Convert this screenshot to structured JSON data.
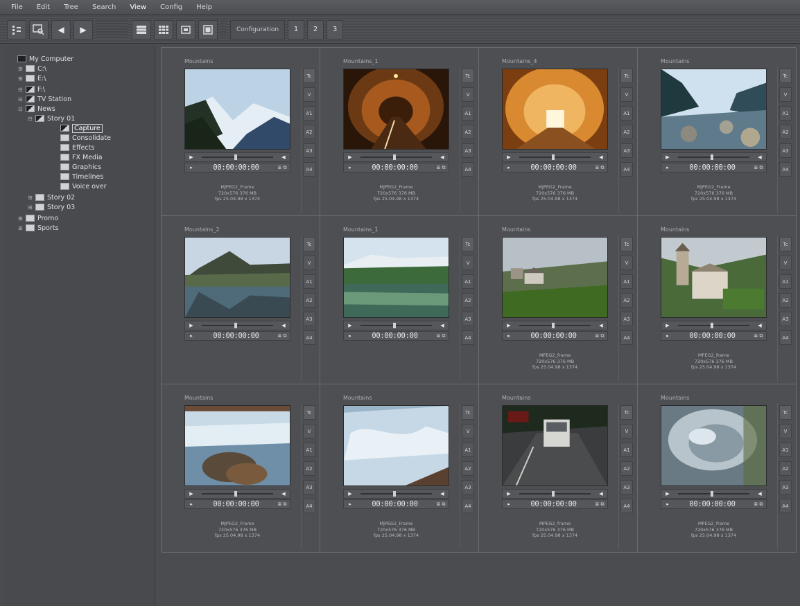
{
  "menu": [
    "File",
    "Edit",
    "Tree",
    "Search",
    "View",
    "Config",
    "Help"
  ],
  "toolbar": {
    "config_label": "Configuration",
    "configs": [
      "1",
      "2",
      "3"
    ]
  },
  "tree": [
    {
      "label": "My Computer",
      "level": 0,
      "exp": "",
      "icon": "pc"
    },
    {
      "label": "C:\\",
      "level": 1,
      "exp": "+",
      "icon": "folder"
    },
    {
      "label": "E:\\",
      "level": 1,
      "exp": "+",
      "icon": "folder"
    },
    {
      "label": "F:\\",
      "level": 1,
      "exp": "−",
      "icon": "open"
    },
    {
      "label": "TV Station",
      "level": 2,
      "exp": "−",
      "icon": "open"
    },
    {
      "label": "News",
      "level": 3,
      "exp": "−",
      "icon": "open"
    },
    {
      "label": "Story 01",
      "level": 4,
      "exp": "−",
      "icon": "open"
    },
    {
      "label": "Capture",
      "level": 5,
      "exp": "",
      "icon": "open",
      "selected": true
    },
    {
      "label": "Consolidate",
      "level": 5,
      "exp": "",
      "icon": "folder"
    },
    {
      "label": "Effects",
      "level": 5,
      "exp": "",
      "icon": "folder"
    },
    {
      "label": "FX Media",
      "level": 5,
      "exp": "",
      "icon": "folder"
    },
    {
      "label": "Graphics",
      "level": 5,
      "exp": "",
      "icon": "folder"
    },
    {
      "label": "Timelines",
      "level": 5,
      "exp": "",
      "icon": "folder"
    },
    {
      "label": "Voice over",
      "level": 5,
      "exp": "",
      "icon": "folder"
    },
    {
      "label": "Story 02",
      "level": 4,
      "exp": "+",
      "icon": "folder"
    },
    {
      "label": "Story 03",
      "level": 4,
      "exp": "+",
      "icon": "folder"
    },
    {
      "label": "Promo",
      "level": 3,
      "exp": "+",
      "icon": "folder"
    },
    {
      "label": "Sports",
      "level": 3,
      "exp": "+",
      "icon": "folder"
    }
  ],
  "tracks": [
    "Tc",
    "V",
    "A1",
    "A2",
    "A3",
    "A4"
  ],
  "clips": [
    {
      "title": "Mountains",
      "timecode": "00:00:00:00",
      "info": [
        "MJPEG2_Frame",
        "720x576 376 MB",
        "fps 25.04.98 x 1374"
      ],
      "scene": "peak"
    },
    {
      "title": "Mountains_1",
      "timecode": "00:00:00:00",
      "info": [
        "MJPEG2_Frame",
        "720x576 376 MB",
        "fps 25.04.98 x 1374"
      ],
      "scene": "tunnel-dark"
    },
    {
      "title": "Mountains_4",
      "timecode": "00:00:00:00",
      "info": [
        "MJPEG2_Frame",
        "720x576 376 MB",
        "fps 25.04.98 x 1374"
      ],
      "scene": "tunnel-light"
    },
    {
      "title": "Mountains",
      "timecode": "00:00:00:00",
      "info": [
        "MJPEG2_Frame",
        "720x576 376 MB",
        "fps 25.04.98 x 1374"
      ],
      "scene": "river-valley"
    },
    {
      "title": "Mountains_2",
      "timecode": "00:00:00:00",
      "info": [],
      "scene": "lake-peak"
    },
    {
      "title": "Mountains_1",
      "timecode": "00:00:00:00",
      "info": [],
      "scene": "lake-green"
    },
    {
      "title": "Mountains",
      "timecode": "00:00:00:00",
      "info": [
        "MPEG2_frame",
        "720x576 376 MB",
        "fps 25.04.98 x 1374"
      ],
      "scene": "meadow-house"
    },
    {
      "title": "Mountains",
      "timecode": "00:00:00:00",
      "info": [
        "MPEG2_frame",
        "720x576 376 MB",
        "fps 25.04.98 x 1374"
      ],
      "scene": "church"
    },
    {
      "title": "Mountains",
      "timecode": "00:00:00:00",
      "info": [
        "MJPEG2_Frame",
        "720x576 376 MB",
        "fps 25.04.98 x 1374"
      ],
      "scene": "rapids"
    },
    {
      "title": "Mountains",
      "timecode": "00:00:00:00",
      "info": [
        "MJPEG2_Frame",
        "720x576 376 MB",
        "fps 25.04.98 x 1374"
      ],
      "scene": "whitewater"
    },
    {
      "title": "Mountains",
      "timecode": "00:00:00:00",
      "info": [
        "MPEG2_frame",
        "720x576 376 MB",
        "fps 25.04.98 x 1374"
      ],
      "scene": "road-car"
    },
    {
      "title": "Mountains",
      "timecode": "00:00:00:00",
      "info": [
        "MPEG2_frame",
        "720x576 376 MB",
        "fps 25.04.98 x 1374"
      ],
      "scene": "water-close"
    }
  ]
}
